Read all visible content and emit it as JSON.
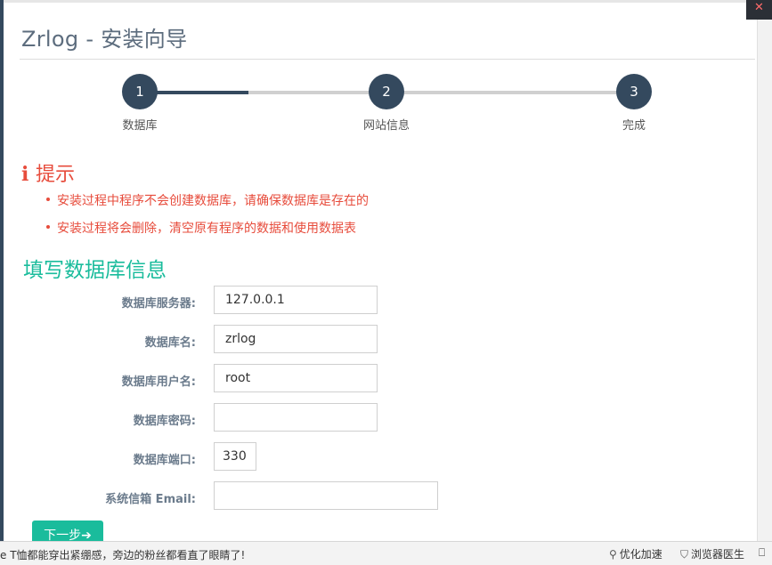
{
  "corner_icon": "close-x-icon",
  "title": "Zrlog - 安装向导",
  "steps": [
    {
      "num": "1",
      "label": "数据库"
    },
    {
      "num": "2",
      "label": "网站信息"
    },
    {
      "num": "3",
      "label": "完成"
    }
  ],
  "step_progress": 0.22,
  "tips": {
    "heading_icon": "i",
    "heading": "提示",
    "items": [
      "安装过程中程序不会创建数据库，请确保数据库是存在的",
      "安装过程将会删除，清空原有程序的数据和使用数据表"
    ]
  },
  "section_title": "填写数据库信息",
  "form": {
    "host": {
      "label": "数据库服务器:",
      "value": "127.0.0.1"
    },
    "dbname": {
      "label": "数据库名:",
      "value": "zrlog"
    },
    "user": {
      "label": "数据库用户名:",
      "value": "root"
    },
    "password": {
      "label": "数据库密码:",
      "value": ""
    },
    "port": {
      "label": "数据库端口:",
      "value": "330"
    },
    "email": {
      "label": "系统信箱 Email:",
      "value": ""
    }
  },
  "next_button": "下一步",
  "next_icon": "➔",
  "status_bar": {
    "news": "e T恤都能穿出紧绷感，旁边的粉丝都看直了眼睛了!",
    "optimize": "优化加速",
    "doctor": "浏览器医生",
    "optimize_icon": "rocket-icon",
    "doctor_icon": "shield-icon"
  },
  "colors": {
    "primary": "#34495e",
    "accent": "#1abc9c",
    "danger": "#e74c3c"
  }
}
